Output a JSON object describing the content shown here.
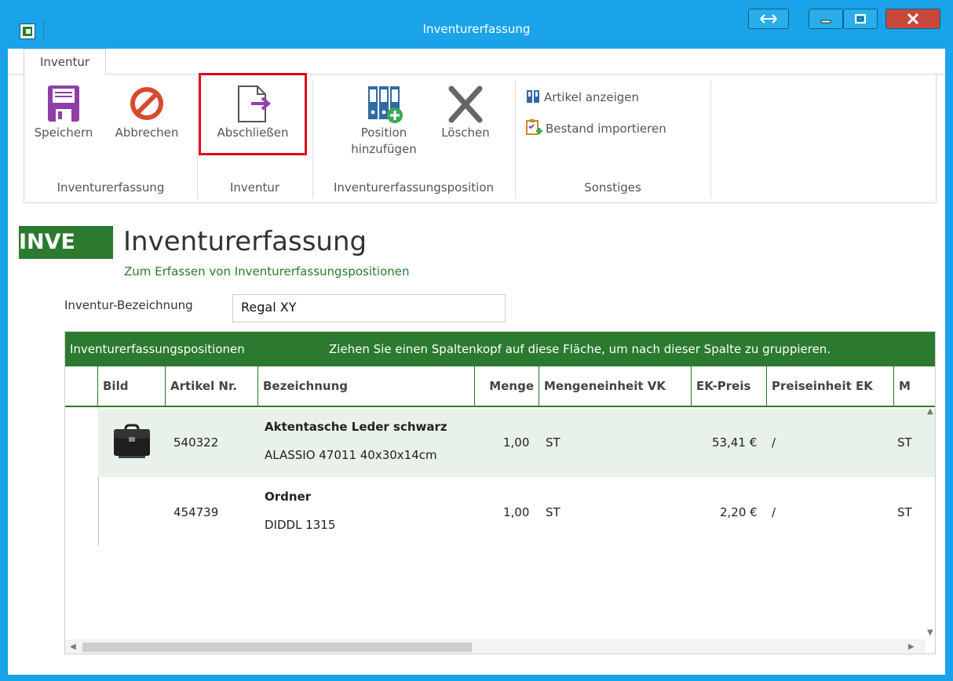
{
  "window": {
    "title": "Inventurerfassung"
  },
  "ribbon": {
    "tab": "Inventur",
    "groups": {
      "erfassung": "Inventurerfassung",
      "inventur": "Inventur",
      "position": "Inventurerfassungsposition",
      "sonstiges": "Sonstiges"
    },
    "buttons": {
      "save": "Speichern",
      "cancel": "Abbrechen",
      "finish": "Abschließen",
      "add_position_line1": "Position",
      "add_position_line2": "hinzufügen",
      "delete": "Löschen",
      "show_article": "Artikel anzeigen",
      "import_stock": "Bestand importieren"
    }
  },
  "header": {
    "badge": "INVE",
    "title": "Inventurerfassung",
    "subtitle": "Zum Erfassen von Inventurerfassungspositionen"
  },
  "form": {
    "label": "Inventur-Bezeichnung",
    "value": "Regal XY"
  },
  "grid": {
    "group_title": "Inventurerfassungspositionen",
    "group_hint": "Ziehen Sie einen Spaltenkopf auf diese Fläche, um nach dieser Spalte zu gruppieren.",
    "columns": [
      "Bild",
      "Artikel Nr.",
      "Bezeichnung",
      "Menge",
      "Mengeneinheit VK",
      "EK-Preis",
      "Preiseinheit EK",
      "M"
    ],
    "rows": [
      {
        "artikel_nr": "540322",
        "name": "Aktentasche Leder schwarz",
        "desc": "ALASSIO 47011 40x30x14cm",
        "menge": "1,00",
        "einheit": "ST",
        "ek_preis": "53,41 €",
        "preiseinheit": "/",
        "m": "ST",
        "has_image": true
      },
      {
        "artikel_nr": "454739",
        "name": "Ordner",
        "desc": "DIDDL 1315",
        "menge": "1,00",
        "einheit": "ST",
        "ek_preis": "2,20 €",
        "preiseinheit": "/",
        "m": "ST",
        "has_image": false
      }
    ]
  },
  "colors": {
    "titlebar": "#1aa3e8",
    "accent_green": "#2b7a2f",
    "highlight_red": "#e2001a",
    "selected_row": "#e8f1ea"
  }
}
